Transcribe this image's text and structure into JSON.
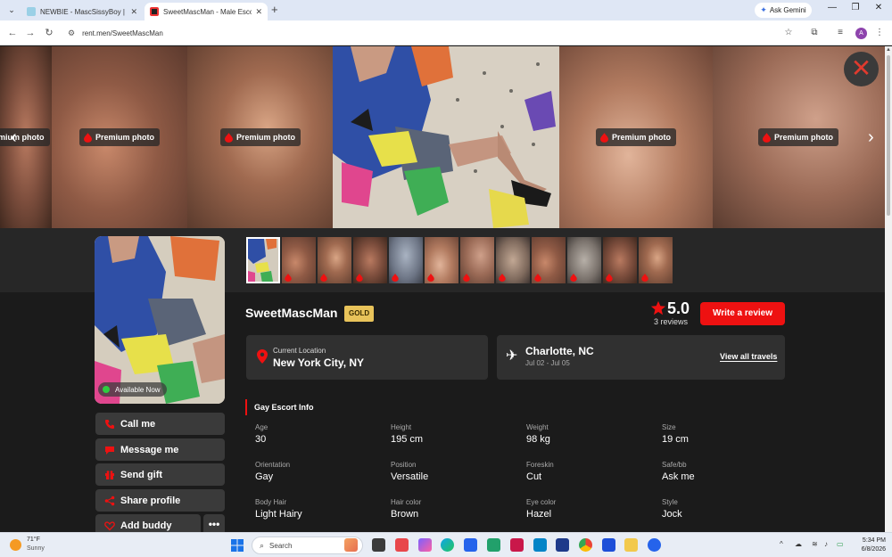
{
  "browser": {
    "tabs": [
      {
        "title": "NEWBIE - MascSissyBoy | The Di",
        "active": false
      },
      {
        "title": "SweetMascMan - Male Escort, C",
        "active": true
      }
    ],
    "ask_gemini": "Ask Gemini",
    "url": "rent.men/SweetMascMan",
    "avatar_letter": "A"
  },
  "gallery": {
    "premium_label": "Premium photo",
    "partial_premium_label": "mium photo"
  },
  "profile": {
    "available": "Available Now",
    "name": "SweetMascMan",
    "badge": "GOLD",
    "rating": "5.0",
    "reviews": "3 reviews",
    "review_button": "Write a review",
    "current_location_label": "Current Location",
    "current_location": "New York City, NY",
    "travel_city": "Charlotte, NC",
    "travel_dates": "Jul 02 - Jul 05",
    "view_travels": "View all travels"
  },
  "actions": {
    "call": "Call me",
    "message": "Message me",
    "gift": "Send gift",
    "share": "Share profile",
    "buddy": "Add buddy",
    "more": "•••"
  },
  "info": {
    "title": "Gay Escort Info",
    "fields": [
      {
        "label": "Age",
        "value": "30"
      },
      {
        "label": "Height",
        "value": "195 cm"
      },
      {
        "label": "Weight",
        "value": "98 kg"
      },
      {
        "label": "Size",
        "value": "19 cm"
      },
      {
        "label": "Orientation",
        "value": "Gay"
      },
      {
        "label": "Position",
        "value": "Versatile"
      },
      {
        "label": "Foreskin",
        "value": "Cut"
      },
      {
        "label": "Safe/bb",
        "value": "Ask me"
      },
      {
        "label": "Body Hair",
        "value": "Light Hairy"
      },
      {
        "label": "Hair color",
        "value": "Brown"
      },
      {
        "label": "Eye color",
        "value": "Hazel"
      },
      {
        "label": "Style",
        "value": "Jock"
      }
    ]
  },
  "taskbar": {
    "temp": "71°F",
    "weather": "Sunny",
    "search_placeholder": "Search",
    "time": "5:34 PM",
    "date": "6/8/2026"
  },
  "colors": {
    "accent_red": "#ee1111",
    "gold": "#e8c35a",
    "background": "#1b1b1b"
  }
}
